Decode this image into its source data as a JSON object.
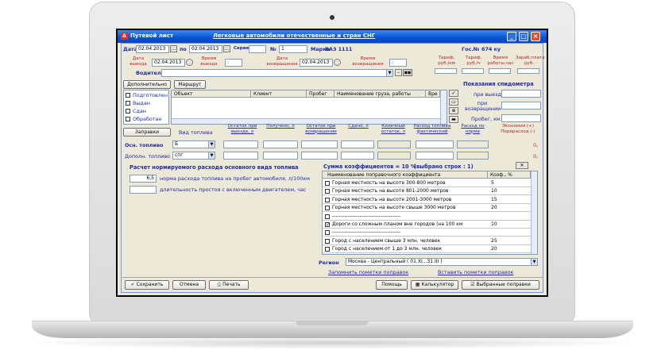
{
  "window": {
    "title": "Путевой лист",
    "subtitle": "Легковые автомобили отечественные и стран СНГ"
  },
  "header": {
    "date_label": "Дата",
    "date_from": "02.04.2013",
    "to_label": "по",
    "date_to": "02.04.2013",
    "series_label": "Серия",
    "number_label": "№",
    "number": "1",
    "brand_label": "Марка",
    "brand_value": "ВАЗ 1111",
    "gosno_label": "Гос.№",
    "gosno_value": "674 ку"
  },
  "departure": {
    "date_label": "Дата выезда",
    "date": "02.04.2013",
    "time_label": "Время выезда",
    "time": ":",
    "return_date_label": "Дата возвращения",
    "return_date": "02.04.2013",
    "return_time_label": "Время возвращения",
    "return_time": ":"
  },
  "tariffs": {
    "km": "Тариф, руб./км",
    "hour": "Тариф, руб./ч",
    "time_work": "Время работы,час",
    "salary": "Зараб.плата руб."
  },
  "driver": {
    "label": "Водитель",
    "value": ""
  },
  "status": {
    "tab_additional": "Дополнительно",
    "tab_route": "Маршрут",
    "items": [
      "Подготовлен",
      "Выдан",
      "Сдан",
      "Обработан"
    ]
  },
  "route_table": {
    "columns": [
      "Объект",
      "Клиент",
      "Пробег",
      "Наименование груза, работы",
      "Вре"
    ]
  },
  "speedometer": {
    "title": "Показания спидометра",
    "on_departure": "при выезде",
    "on_return": "при возвращении",
    "mileage": "Пробег, км"
  },
  "fuel": {
    "refuel_button": "Заправки",
    "type_header": "Вид топлива",
    "headers": [
      "Остаток при выезде, л",
      "Получено, л",
      "Остаток при возвращении",
      "Сдано, л",
      "Конечный остаток, л",
      "Расход топлива фактический",
      "Расход по норме",
      "Экономия (+) Перерасход (-)"
    ],
    "main_label": "Осн. топливо",
    "main_type": "Б",
    "main_economy": "0,",
    "extra_label": "Дополн. топливо",
    "extra_type": "спг",
    "extra_economy": "0,"
  },
  "norm": {
    "title": "Расчет нормируемого расхода основного вида топлива",
    "rate_value": "6,5",
    "rate_label": "норма расхода топлива на пробег автомобиля, л/100км",
    "idle_value": "",
    "idle_label": "длительность простоя с включенным двигателем, час"
  },
  "coefficients": {
    "title": "Сумма коэффициентов = 10 %",
    "selected": "(выбрано строк : 1)",
    "col_name": "Наименование поправочного коэффициента",
    "col_value": "Коэф., %",
    "rows": [
      {
        "checked": false,
        "name": "Горная местность на высоте 300-800 метров",
        "value": "5"
      },
      {
        "checked": false,
        "name": "Горная местность на высоте 801-2000 метров",
        "value": "10"
      },
      {
        "checked": false,
        "name": "Горная местность на высоте 2001-3000 метров",
        "value": "15"
      },
      {
        "checked": false,
        "name": "Горная местность на высоте свыше 3000 метров",
        "value": "20"
      },
      {
        "checked": false,
        "name": "----------------------------------------",
        "value": ""
      },
      {
        "checked": true,
        "name": "Дороги со сложным планом вне городов (на 100 км",
        "value": "10"
      },
      {
        "checked": false,
        "name": "----------------------------------------",
        "value": ""
      },
      {
        "checked": false,
        "name": "Город с населением свыше 3 млн. человек",
        "value": "25"
      },
      {
        "checked": false,
        "name": "Город с населением от 1 до 3 млн. человек",
        "value": "20"
      }
    ]
  },
  "region": {
    "label": "Регион",
    "value": "Москва - Центральный ( 01.XI...31.III )",
    "remember_link": "Запомнить пометки поправок",
    "insert_link": "Вставить пометки поправок"
  },
  "footer": {
    "save": "Сохранить",
    "cancel": "Отмена",
    "print": "Печать",
    "help": "Помощь",
    "calculator": "Калькулятор",
    "selected_corrections": "Выбранные поправки"
  },
  "colors": {
    "title_bar": "#0a52d6",
    "label_blue": "#1f2ba8",
    "label_red": "#c0202a",
    "window_bg": "#ece9d8"
  }
}
